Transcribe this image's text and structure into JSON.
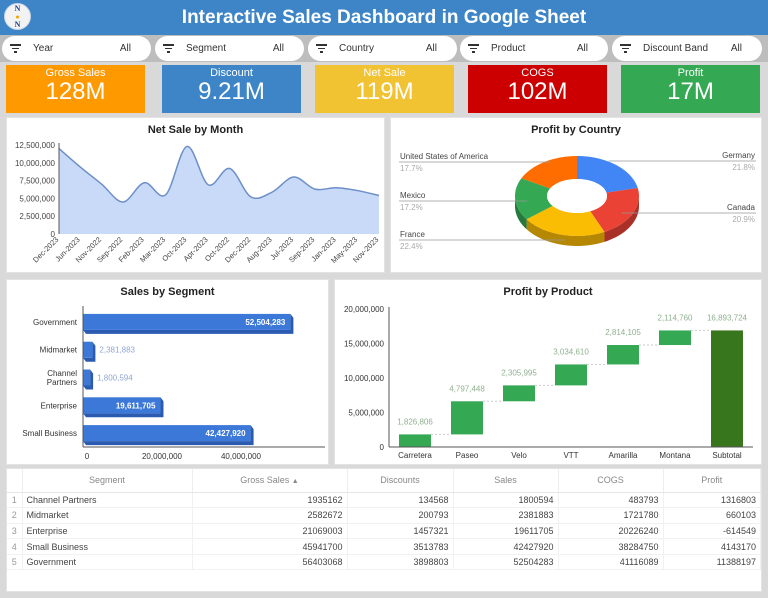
{
  "header": {
    "title": "Interactive Sales Dashboard in Google Sheet",
    "logo_icon": "nn-logo",
    "logo_letters": [
      "N",
      "●",
      "N"
    ]
  },
  "filters": [
    {
      "label": "Year",
      "value": "All",
      "icon": "filter-icon"
    },
    {
      "label": "Segment",
      "value": "All",
      "icon": "filter-icon"
    },
    {
      "label": "Country",
      "value": "All",
      "icon": "filter-icon"
    },
    {
      "label": "Product",
      "value": "All",
      "icon": "filter-icon"
    },
    {
      "label": "Discount Band",
      "value": "All",
      "icon": "filter-icon"
    }
  ],
  "kpis": [
    {
      "label": "Gross Sales",
      "value": "128M",
      "color": "#ff9900"
    },
    {
      "label": "Discount",
      "value": "9.21M",
      "color": "#3d85c6"
    },
    {
      "label": "Net Sale",
      "value": "119M",
      "color": "#f1c232"
    },
    {
      "label": "COGS",
      "value": "102M",
      "color": "#cc0000"
    },
    {
      "label": "Profit",
      "value": "17M",
      "color": "#34a853"
    }
  ],
  "chart_data": [
    {
      "type": "area",
      "title": "Net Sale by Month",
      "xlabel": "",
      "ylabel": "",
      "categories": [
        "Dec-2023",
        "Jun-2023",
        "Nov-2022",
        "Sep-2022",
        "Feb-2023",
        "Mar-2023",
        "Oct-2023",
        "Apr-2023",
        "Oct-2022",
        "Dec-2022",
        "Aug-2023",
        "Jul-2023",
        "Sep-2023",
        "Jan-2023",
        "May-2023",
        "Nov-2023"
      ],
      "values": [
        12000000,
        9400000,
        7000000,
        4500000,
        7200000,
        5500000,
        12300000,
        6900000,
        9200000,
        5200000,
        5900000,
        8000000,
        6300000,
        6500000,
        6100000,
        5400000
      ],
      "yticks": [
        "0",
        "2,500,000",
        "5,000,000",
        "7,500,000",
        "10,000,000",
        "12,500,000"
      ],
      "ylim": [
        0,
        12500000
      ],
      "color": "#6d8fc7",
      "fill": "#c9daf8"
    },
    {
      "type": "pie",
      "title": "Profit by Country",
      "donut": true,
      "slices": [
        {
          "label": "Germany",
          "value": 21.8,
          "pct": "21.8%",
          "color": "#4285f4"
        },
        {
          "label": "Canada",
          "value": 20.9,
          "pct": "20.9%",
          "color": "#ea4335"
        },
        {
          "label": "France",
          "value": 22.4,
          "pct": "22.4%",
          "color": "#fbbc04"
        },
        {
          "label": "Mexico",
          "value": 17.2,
          "pct": "17.2%",
          "color": "#34a853"
        },
        {
          "label": "United States of America",
          "value": 17.7,
          "pct": "17.7%",
          "color": "#ff6d01"
        }
      ]
    },
    {
      "type": "bar",
      "orientation": "horizontal",
      "title": "Sales by Segment",
      "categories": [
        "Government",
        "Midmarket",
        "Channel Partners",
        "Enterprise",
        "Small Business"
      ],
      "category_lines": [
        [
          "Government"
        ],
        [
          "Midmarket"
        ],
        [
          "Channel",
          "Partners"
        ],
        [
          "Enterprise"
        ],
        [
          "Small Business"
        ]
      ],
      "values": [
        52504283,
        2381883,
        1800594,
        19611705,
        42427920
      ],
      "data_labels": [
        "52,504,283",
        "2,381,883",
        "1,800,594",
        "19,611,705",
        "42,427,920"
      ],
      "xticks": [
        "0",
        "20,000,000",
        "40,000,000"
      ],
      "xlim": [
        0,
        60000000
      ],
      "color": "#3c78d8"
    },
    {
      "type": "bar",
      "subtype": "waterfall",
      "title": "Profit by Product",
      "categories": [
        "Carretera",
        "Paseo",
        "Velo",
        "VTT",
        "Amarilla",
        "Montana",
        "Subtotal"
      ],
      "values": [
        1826806,
        4797448,
        2305995,
        3034610,
        2814105,
        2114760,
        16893724
      ],
      "data_labels": [
        "1,826,806",
        "4,797,448",
        "2,305,995",
        "3,034,610",
        "2,814,105",
        "2,114,760",
        "16,893,724"
      ],
      "yticks": [
        "0",
        "5,000,000",
        "10,000,000",
        "15,000,000",
        "20,000,000"
      ],
      "ylim": [
        0,
        20000000
      ],
      "color": "#34a853",
      "subtotal_color": "#38761d"
    }
  ],
  "table": {
    "columns": [
      "Segment",
      "Gross Sales",
      "Discounts",
      "Sales",
      "COGS",
      "Profit"
    ],
    "sort_indicator": "▲",
    "sorted_column": "Gross Sales",
    "rows": [
      {
        "idx": "1",
        "cells": [
          "Channel Partners",
          "1935162",
          "134568",
          "1800594",
          "483793",
          "1316803"
        ]
      },
      {
        "idx": "2",
        "cells": [
          "Midmarket",
          "2582672",
          "200793",
          "2381883",
          "1721780",
          "660103"
        ]
      },
      {
        "idx": "3",
        "cells": [
          "Enterprise",
          "21069003",
          "1457321",
          "19611705",
          "20226240",
          "-614549"
        ]
      },
      {
        "idx": "4",
        "cells": [
          "Small Business",
          "45941700",
          "3513783",
          "42427920",
          "38284750",
          "4143170"
        ]
      },
      {
        "idx": "5",
        "cells": [
          "Government",
          "56403068",
          "3898803",
          "52504283",
          "41116089",
          "11388197"
        ]
      }
    ]
  }
}
